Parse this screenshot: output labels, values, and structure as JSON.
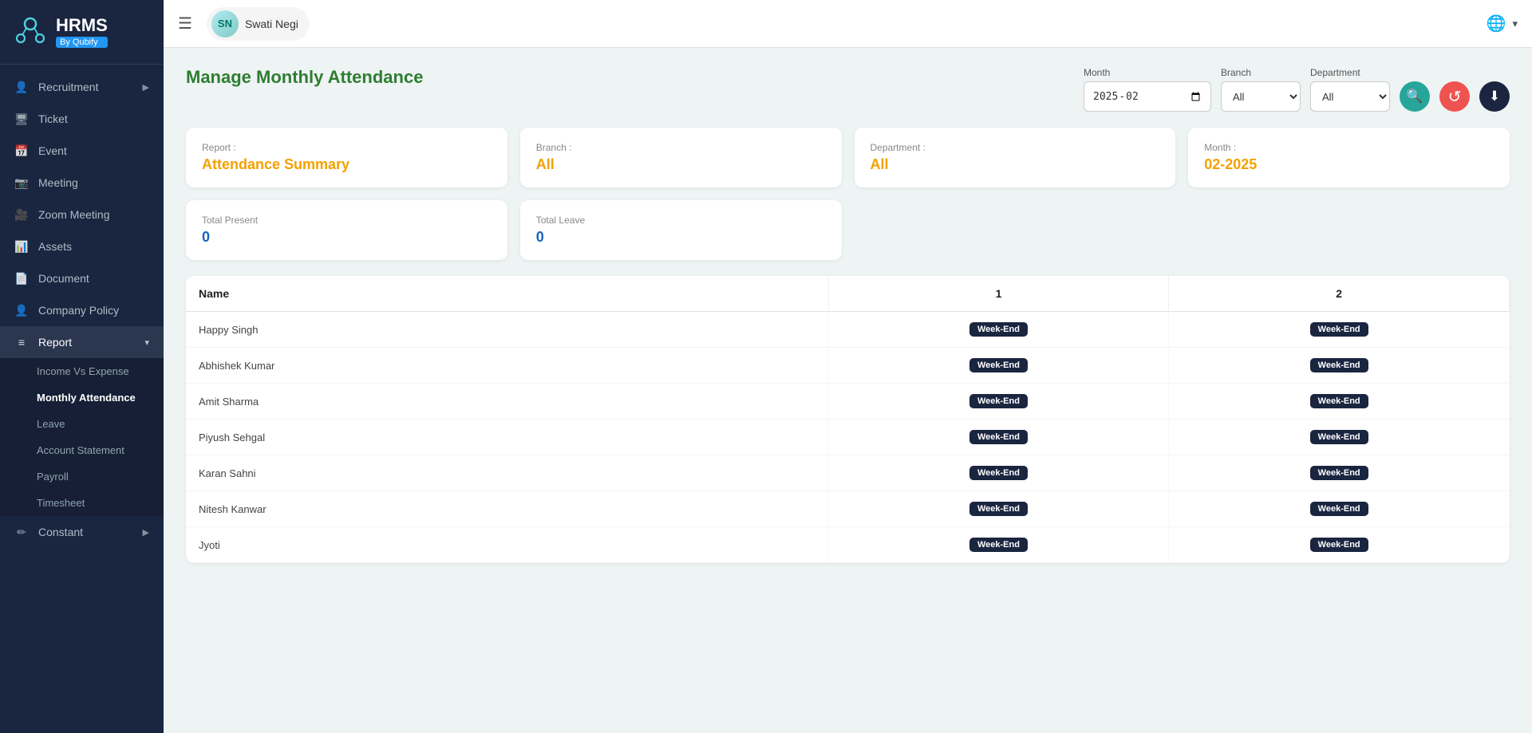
{
  "app": {
    "name": "HRMS",
    "tagline": "By Qubify"
  },
  "topbar": {
    "hamburger": "☰",
    "user": {
      "name": "Swati Negi",
      "initials": "SN"
    }
  },
  "sidebar": {
    "items": [
      {
        "id": "recruitment",
        "label": "Recruitment",
        "icon": "👤",
        "hasArrow": true
      },
      {
        "id": "ticket",
        "label": "Ticket",
        "icon": "🖥"
      },
      {
        "id": "event",
        "label": "Event",
        "icon": "📅"
      },
      {
        "id": "meeting",
        "label": "Meeting",
        "icon": "📷"
      },
      {
        "id": "zoom-meeting",
        "label": "Zoom Meeting",
        "icon": "🎥"
      },
      {
        "id": "assets",
        "label": "Assets",
        "icon": "📊"
      },
      {
        "id": "document",
        "label": "Document",
        "icon": "📄"
      },
      {
        "id": "company-policy",
        "label": "Company Policy",
        "icon": "👤"
      },
      {
        "id": "report",
        "label": "Report",
        "icon": "≡",
        "hasArrow": true,
        "active": true
      }
    ],
    "report_subnav": [
      {
        "id": "income-vs-expense",
        "label": "Income Vs Expense"
      },
      {
        "id": "monthly-attendance",
        "label": "Monthly Attendance",
        "active": true
      },
      {
        "id": "leave",
        "label": "Leave"
      },
      {
        "id": "account-statement",
        "label": "Account Statement"
      },
      {
        "id": "payroll",
        "label": "Payroll"
      },
      {
        "id": "timesheet",
        "label": "Timesheet"
      }
    ],
    "bottom_items": [
      {
        "id": "constant",
        "label": "Constant",
        "icon": "✏",
        "hasArrow": true
      }
    ]
  },
  "page": {
    "title": "Manage Monthly Attendance"
  },
  "filters": {
    "month_label": "Month",
    "month_value": "2025-02",
    "month_display": "February 2025",
    "branch_label": "Branch",
    "branch_value": "All",
    "department_label": "Department",
    "department_value": "All"
  },
  "info_cards": [
    {
      "label": "Report :",
      "value": "Attendance Summary"
    },
    {
      "label": "Branch :",
      "value": "All"
    },
    {
      "label": "Department :",
      "value": "All"
    },
    {
      "label": "Month :",
      "value": "02-2025"
    }
  ],
  "summary_cards": [
    {
      "label": "Total Present",
      "value": "0"
    },
    {
      "label": "Total Leave",
      "value": "0"
    }
  ],
  "table": {
    "columns": [
      "Name",
      "1",
      "2"
    ],
    "rows": [
      {
        "name": "Happy Singh",
        "day1": "Week-End",
        "day2": "Week-End"
      },
      {
        "name": "Abhishek Kumar",
        "day1": "Week-End",
        "day2": "Week-End"
      },
      {
        "name": "Amit Sharma",
        "day1": "Week-End",
        "day2": "Week-End"
      },
      {
        "name": "Piyush Sehgal",
        "day1": "Week-End",
        "day2": "Week-End"
      },
      {
        "name": "Karan Sahni",
        "day1": "Week-End",
        "day2": "Week-End"
      },
      {
        "name": "Nitesh Kanwar",
        "day1": "Week-End",
        "day2": "Week-End"
      },
      {
        "name": "Jyoti",
        "day1": "Week-End",
        "day2": "Week-End"
      }
    ]
  },
  "buttons": {
    "search": "🔍",
    "reset": "↺",
    "download": "⬇"
  }
}
